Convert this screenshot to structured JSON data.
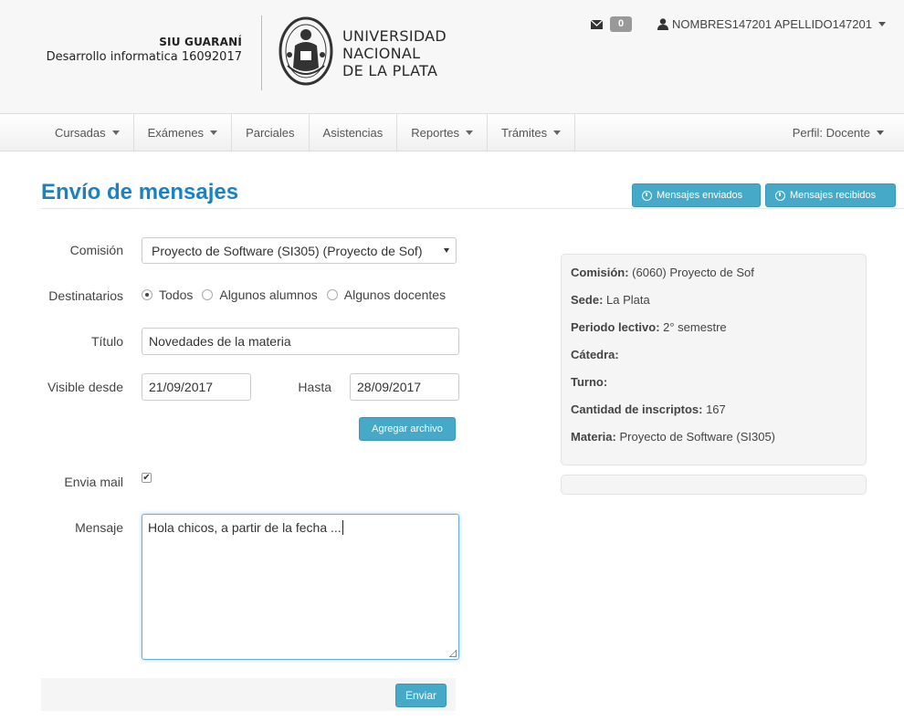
{
  "brand": {
    "title": "SIU GUARANÍ",
    "subtitle": "Desarrollo informatica 16092017",
    "university_lines": [
      "UNIVERSIDAD",
      "NACIONAL",
      "DE LA PLATA"
    ]
  },
  "topbar": {
    "mail_count": "0",
    "user_name": "NOMBRES147201 APELLIDO147201"
  },
  "nav": {
    "items": [
      {
        "label": "Cursadas",
        "dropdown": true
      },
      {
        "label": "Exámenes",
        "dropdown": true
      },
      {
        "label": "Parciales",
        "dropdown": false
      },
      {
        "label": "Asistencias",
        "dropdown": false
      },
      {
        "label": "Reportes",
        "dropdown": true
      },
      {
        "label": "Trámites",
        "dropdown": true
      }
    ],
    "perfil": "Perfil: Docente"
  },
  "page": {
    "title": "Envío de mensajes",
    "btn_sent": "Mensajes enviados",
    "btn_received": "Mensajes recibidos"
  },
  "form": {
    "comision_label": "Comisión",
    "comision_value": "Proyecto de Software (SI305) (Proyecto de Sof)",
    "destinatarios_label": "Destinatarios",
    "destinatarios_options": [
      "Todos",
      "Algunos alumnos",
      "Algunos docentes"
    ],
    "destinatarios_selected": "Todos",
    "titulo_label": "Título",
    "titulo_value": "Novedades de la materia",
    "visible_desde_label": "Visible desde",
    "visible_desde_value": "21/09/2017",
    "hasta_label": "Hasta",
    "hasta_value": "28/09/2017",
    "attach_button": "Agregar archivo",
    "envia_mail_label": "Envia mail",
    "envia_mail_checked": true,
    "mensaje_label": "Mensaje",
    "mensaje_value": "Hola chicos, a partir de la fecha ...",
    "send_button": "Enviar"
  },
  "info": {
    "rows": [
      {
        "label": "Comisión:",
        "value": " (6060) Proyecto de Sof"
      },
      {
        "label": "Sede:",
        "value": " La Plata"
      },
      {
        "label": "Periodo lectivo:",
        "value": " 2° semestre"
      },
      {
        "label": "Cátedra:",
        "value": ""
      },
      {
        "label": "Turno:",
        "value": ""
      },
      {
        "label": "Cantidad de inscriptos:",
        "value": " 167"
      },
      {
        "label": "Materia:",
        "value": " Proyecto de Software (SI305)"
      }
    ]
  },
  "colors": {
    "accent": "#1a82c4",
    "button_info": "#46a9c8",
    "header_bg": "#f7f7f7",
    "panel_bg": "#f5f5f5"
  }
}
